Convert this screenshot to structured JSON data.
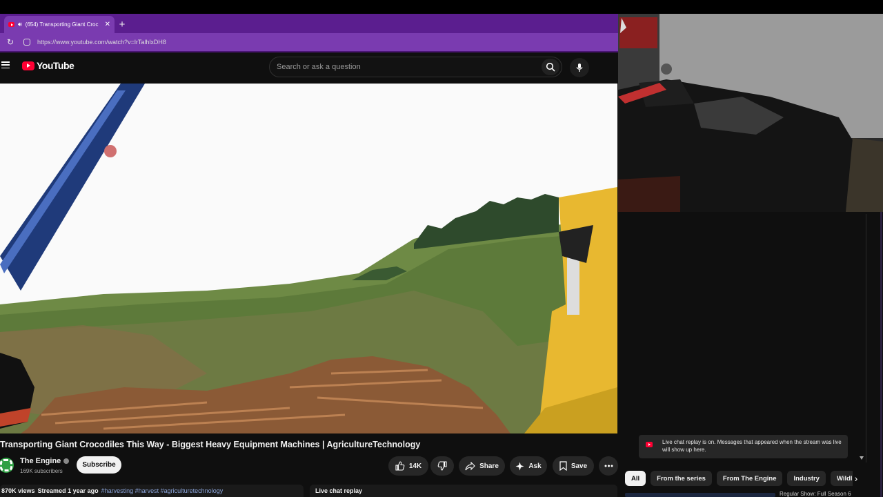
{
  "browser": {
    "tab_title": "(654) Transporting Giant Croc",
    "url": "https://www.youtube.com/watch?v=lrTalhlxDH8"
  },
  "youtube": {
    "logo_text": "YouTube",
    "search_placeholder": "Search or ask a question"
  },
  "video": {
    "title": "Transporting Giant Crocodiles This Way - Biggest Heavy Equipment Machines | AgricultureTechnology",
    "channel": "The Engine",
    "subscribers": "169K subscribers",
    "subscribe_label": "Subscribe",
    "likes": "14K",
    "share_label": "Share",
    "ask_label": "Ask",
    "save_label": "Save",
    "views": "870K views",
    "streamed": "Streamed 1 year ago",
    "hashtags": "#harvesting #harvest #agriculturetechnology"
  },
  "chat": {
    "replay_label": "Live chat replay",
    "notice": "Live chat replay is on. Messages that appeared when the stream was live will show up here."
  },
  "chips": [
    "All",
    "From the series",
    "From The Engine",
    "Industry",
    "Wildlife"
  ],
  "next_video_title": "Regular Show: Full Season 6",
  "colors": {
    "tab_purple": "#7a3bb0",
    "yt_red": "#ff0033",
    "dark_bg": "#0f0f0f"
  }
}
